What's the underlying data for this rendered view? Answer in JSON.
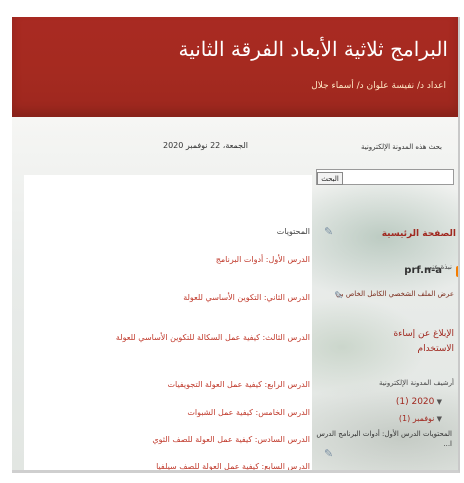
{
  "header": {
    "title": "البرامج ثلاثية الأبعاد الفرقة الثانية",
    "subtitle": "اعداد د/ نفيسة علوان د/ أسماء جلال"
  },
  "bar": {
    "archive_label": "بحث هذه المدونة الإلكترونية",
    "date": "الجمعة، 22 نوفمبر 2020"
  },
  "search": {
    "button_label": "البحث"
  },
  "content": {
    "heading": "المحتويات",
    "lessons": [
      "الدرس الأول: أدوات البرنامج",
      "الدرس الثاني: التكوين الأساسي للعولة",
      "الدرس الثالث: كيفية عمل السكالة للتكوين الأساسي للعولة",
      "الدرس الرابع: كيفية عمل العولة التجويفيات",
      "الدرس الخامس: كيفية عمل الشبوات",
      "الدرس السادس: كيفية عمل العولة للصف الثوي",
      "الدرس السابع: كيفية عمل العولة للصف سيلفيا"
    ]
  },
  "sidebar": {
    "home": "الصفحة الرئيسية",
    "about": "نبذة عني",
    "profile_name": "prf.n-a",
    "course": "عرض الملف الشخصي الكامل الخاص بي",
    "report_line1": "الإبلاغ عن إساءة",
    "report_line2": "الاستخدام",
    "archive_heading": "أرشيف المدونة الإلكترونية",
    "year": "2020 (1)",
    "month": "نوفمبر (1)",
    "post_line1": "المحتويات الدرس الأول: أدوات البرنامج الدرس",
    "post_line2": "ا..."
  },
  "icons": {
    "edit": "pencil-icon",
    "blogger": "blogger-icon",
    "expand": "triangle-down-icon"
  },
  "colors": {
    "header_bg": "#a52a20",
    "link": "#c0392b",
    "accent": "#a0281f"
  }
}
